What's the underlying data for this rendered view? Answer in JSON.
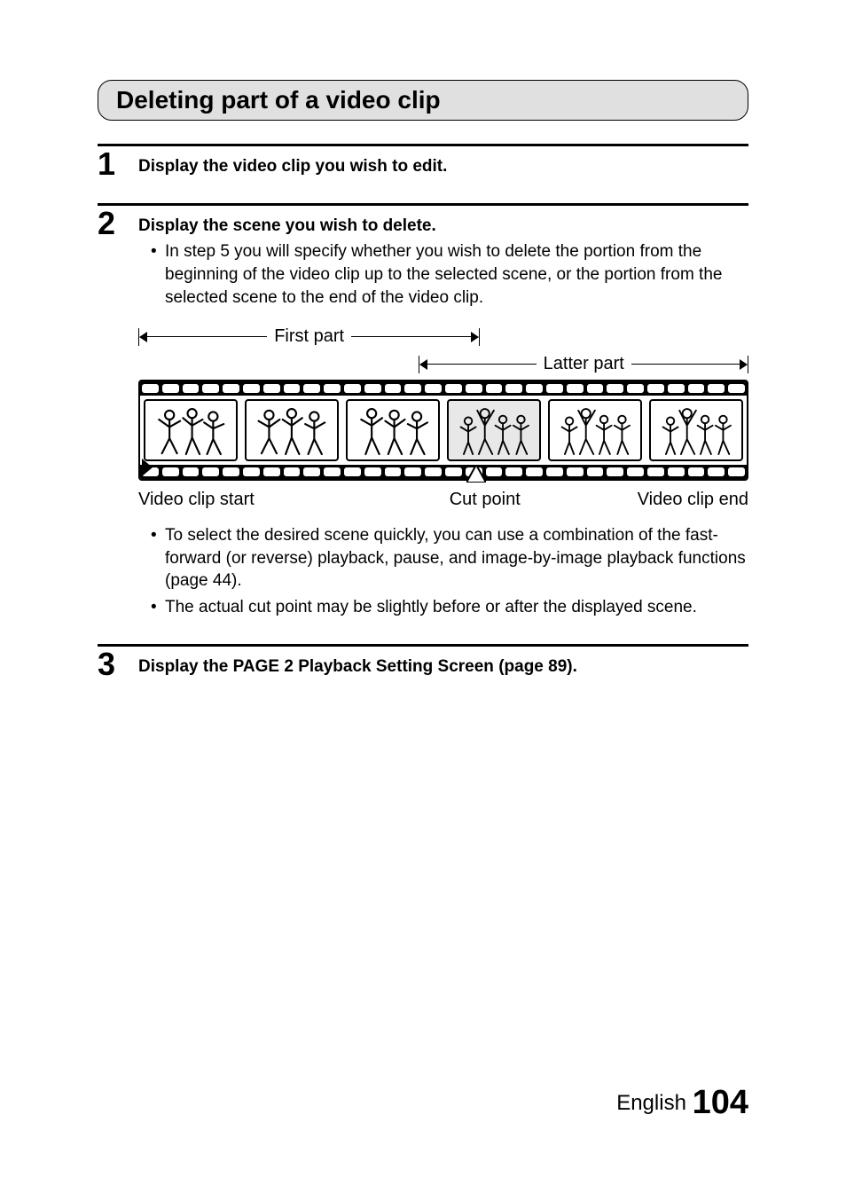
{
  "section_title": "Deleting part of a video clip",
  "steps": [
    {
      "number": "1",
      "heading": "Display the video clip you wish to edit.",
      "bullets": []
    },
    {
      "number": "2",
      "heading": "Display the scene you wish to delete.",
      "bullets": [
        "In step 5 you will specify whether you wish to delete the portion from the beginning of the video clip up to the selected scene, or the portion from the selected scene to the end of the video clip."
      ],
      "bullets_after": [
        "To select the desired scene quickly, you can use a combination of the fast-forward (or reverse) playback, pause, and image-by-image playback functions (page 44).",
        "The actual cut point may be slightly before or after the displayed scene."
      ]
    },
    {
      "number": "3",
      "heading": "Display the PAGE 2 Playback Setting Screen (page 89).",
      "bullets": []
    }
  ],
  "diagram": {
    "first_part_label": "First part",
    "latter_part_label": "Latter part",
    "start_label": "Video clip start",
    "cut_label": "Cut point",
    "end_label": "Video clip end"
  },
  "footer": {
    "language": "English",
    "page_number": "104"
  }
}
